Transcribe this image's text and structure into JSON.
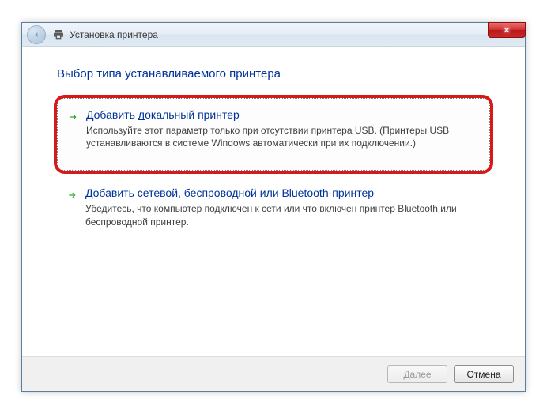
{
  "window": {
    "title": "Установка принтера"
  },
  "heading": "Выбор типа устанавливаемого принтера",
  "options": [
    {
      "title_pre": "Добавить ",
      "title_u": "л",
      "title_post": "окальный принтер",
      "desc": "Используйте этот параметр только при отсутствии принтера USB. (Принтеры USB устанавливаются в системе Windows автоматически при их подключении.)"
    },
    {
      "title_pre": "Добавить ",
      "title_u": "с",
      "title_post": "етевой, беспроводной или Bluetooth-принтер",
      "desc": "Убедитесь, что компьютер подключен к сети или что включен принтер Bluetooth или беспроводной принтер."
    }
  ],
  "footer": {
    "next_u": "Д",
    "next_post": "алее",
    "cancel": "Отмена"
  }
}
